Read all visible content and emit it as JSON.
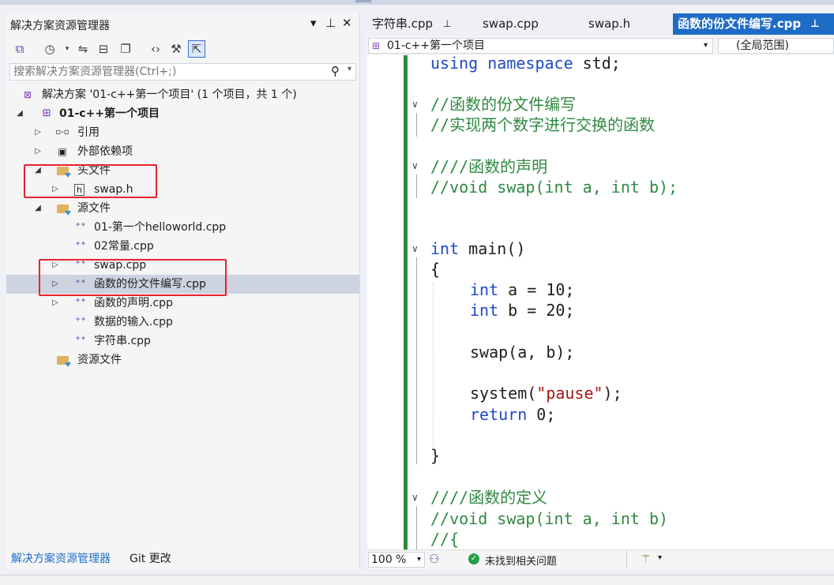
{
  "solution_panel": {
    "title": "解决方案资源管理器",
    "dropdown_glyph": "▾",
    "pin_glyph": "⊥",
    "close_glyph": "✕",
    "search_placeholder": "搜索解决方案资源管理器(Ctrl+;)",
    "tree": {
      "solution": "解决方案 '01-c++第一个项目' (1 个项目，共 1 个)",
      "project": "01-c++第一个项目",
      "references": "引用",
      "external_deps": "外部依赖项",
      "header_folder": "头文件",
      "header_file": "swap.h",
      "source_folder": "源文件",
      "sources": [
        "01-第一个helloworld.cpp",
        "02常量.cpp",
        "swap.cpp",
        "函数的份文件编写.cpp",
        "函数的声明.cpp",
        "数据的输入.cpp",
        "字符串.cpp"
      ],
      "resource_folder": "资源文件"
    },
    "bottom_tabs": [
      "解决方案资源管理器",
      "Git 更改"
    ]
  },
  "editor": {
    "tabs": [
      "字符串.cpp",
      "swap.cpp",
      "swap.h",
      "函数的份文件编写.cpp"
    ],
    "active_tab_index": 3,
    "nav_project": "01-c++第一个项目",
    "nav_scope": "(全局范围)",
    "code": {
      "l1_kw1": "using",
      "l1_kw2": "namespace",
      "l1_rest": " std;",
      "c1": "//函数的份文件编写",
      "c2": "//实现两个数字进行交换的函数",
      "c3": "////函数的声明",
      "c4": "//void swap(int a, int b);",
      "main_kw": "int",
      "main_rest": " main()",
      "brace_open": "{",
      "a_kw": "int",
      "a_rest": " a = 10;",
      "b_kw": "int",
      "b_rest": " b = 20;",
      "swap_call": "swap(a, b);",
      "sys_fn": "system(",
      "sys_str": "\"pause\"",
      "sys_end": ");",
      "ret_kw": "return",
      "ret_rest": " 0;",
      "brace_close": "}",
      "c5": "////函数的定义",
      "c6": "//void swap(int a, int b)",
      "c7": "//{"
    },
    "zoom": "100 %",
    "status": "未找到相关问题"
  },
  "colors": {
    "active_tab": "#1f6cc7",
    "keyword": "#1f49c7",
    "comment": "#2f8a41",
    "string": "#a31515",
    "highlight_box": "#e8232d"
  }
}
